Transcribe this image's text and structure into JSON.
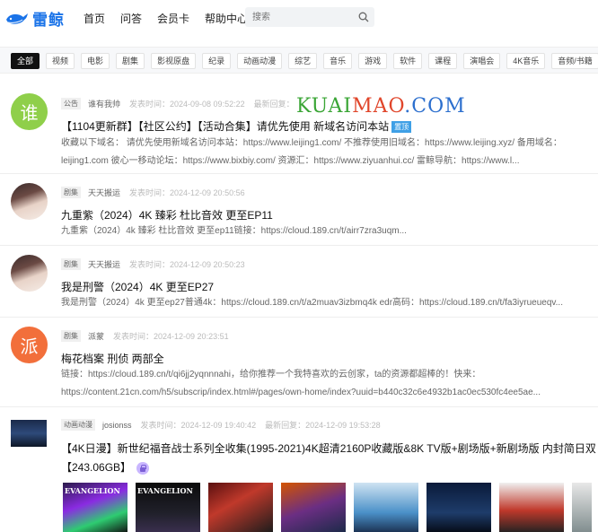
{
  "header": {
    "logo_text": "雷鲸",
    "nav": [
      "首页",
      "问答",
      "会员卡",
      "帮助中心"
    ],
    "search_placeholder": "搜索"
  },
  "categories": [
    "全部",
    "视频",
    "电影",
    "剧集",
    "影视原盘",
    "纪录",
    "动画动漫",
    "综艺",
    "音乐",
    "游戏",
    "软件",
    "课程",
    "演唱会",
    "4K音乐",
    "音频/书籍"
  ],
  "watermark": {
    "part1": "KUAI",
    "part2": "MAO",
    "part3": ".COM"
  },
  "posts": [
    {
      "avatar_char": "谁",
      "tag": "公告",
      "user": "谁有我帅",
      "time": "发表时间：2024-09-08 09:52:22",
      "reply_label": "最新回复：",
      "title": "【1104更新群】【社区公约】【活动合集】请优先使用 新域名访问本站",
      "badge": "置顶",
      "excerpt": "收藏以下域名： 请优先使用新域名访问本站：https://www.leijing1.com/ 不推荐使用旧域名：https://www.leijing.xyz/ 备用域名：leijing1.com 彼心一移动论坛：https://www.bixbiy.com/ 资源汇：https://www.ziyuanhui.cc/ 雷鲸导航：https://www.l..."
    },
    {
      "tag": "剧集",
      "user": "天天搬运",
      "time": "发表时间：2024-12-09 20:50:56",
      "title": "九重紫（2024）4K 臻彩 杜比音效 更至EP11",
      "excerpt": "九重紫（2024）4k 臻彩 杜比音效 更至ep11链接：https://cloud.189.cn/t/airr7zra3uqm..."
    },
    {
      "tag": "剧集",
      "user": "天天搬运",
      "time": "发表时间：2024-12-09 20:50:23",
      "title": "我是刑警（2024）4K 更至EP27",
      "excerpt": "我是刑警（2024）4k 更至ep27普通4k：https://cloud.189.cn/t/a2muav3izbmq4k edr高码：https://cloud.189.cn/t/fa3iyrueueqv..."
    },
    {
      "avatar_char": "派",
      "tag": "剧集",
      "user": "派蒙",
      "time": "发表时间：2024-12-09 20:23:51",
      "title": "梅花档案 刑侦 两部全",
      "excerpt": "链接：https://cloud.189.cn/t/qi6jj2yqnnnahi，给你推荐一个我特喜欢的云创家，ta的资源都超棒的！快来：https://content.21cn.com/h5/subscrip/index.html#/pages/own-home/index?uuid=b440c32c6e4932b1ac0ec530fc4ee5ae..."
    },
    {
      "tag": "动画动漫",
      "user": "josionss",
      "time": "发表时间：2024-12-09 19:40:42",
      "reply": "最新回复：2024-12-09 19:53:28",
      "title": "【4K日漫】新世纪福音战士系列全收集(1995-2021)4K超清2160P收藏版&8K TV版+剧场版+新剧场版 内封简日双",
      "title2": "【243.06GB】"
    }
  ],
  "thumbs": [
    "EVANGELION",
    "EVANGELION",
    "",
    "",
    "",
    "",
    "",
    ""
  ]
}
